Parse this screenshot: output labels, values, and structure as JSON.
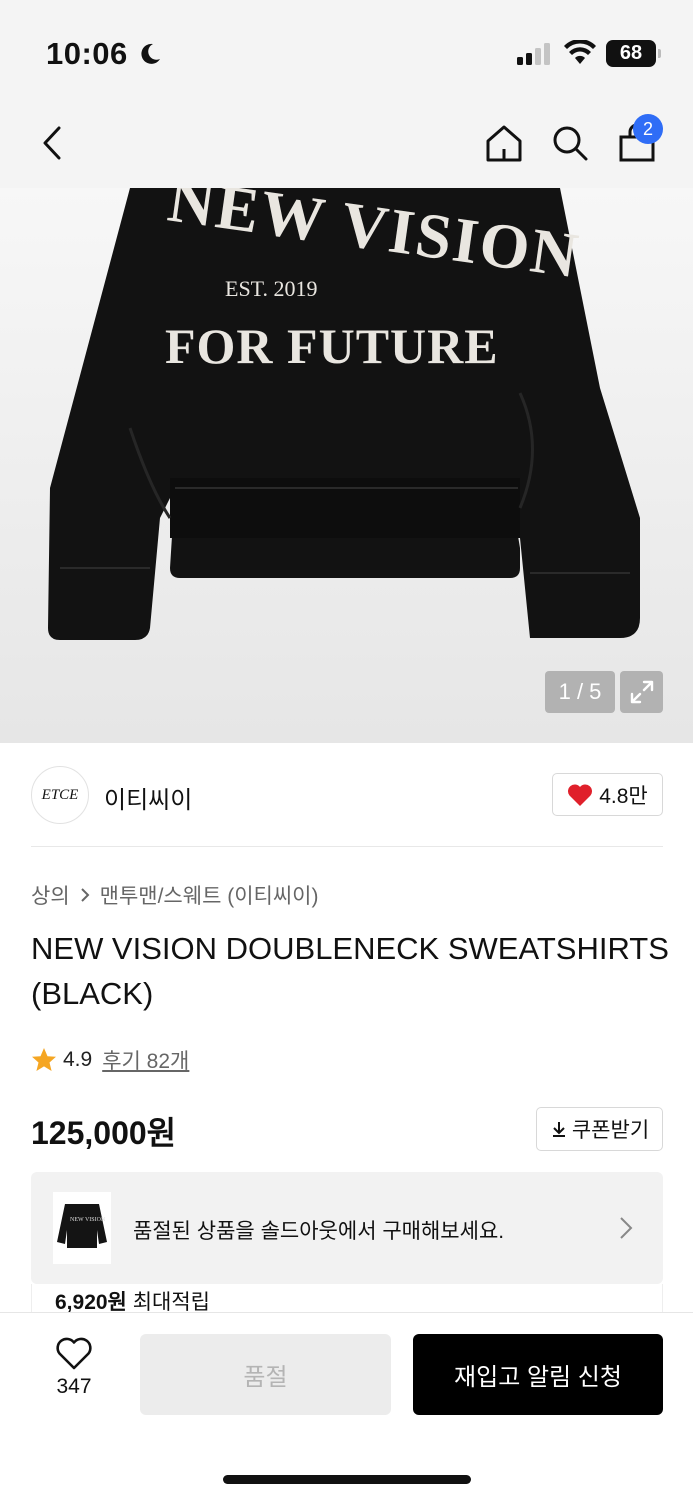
{
  "status_bar": {
    "time": "10:06",
    "battery": "68"
  },
  "nav": {
    "cart_count": "2",
    "icons": [
      "back-arrow-icon",
      "home-icon",
      "search-icon",
      "shopping-bag-icon"
    ]
  },
  "gallery": {
    "image_print_lines": [
      "NEW VISION",
      "EST. 2019",
      "FOR FUTURE"
    ],
    "counter": "1 / 5"
  },
  "brand": {
    "logo_text": "ETCE",
    "name": "이티씨이",
    "likes": "4.8만"
  },
  "product": {
    "breadcrumb": [
      "상의",
      "맨투맨/스웨트 (이티씨이)"
    ],
    "title": "NEW VISION DOUBLENECK SWEATSHIRTS (BLACK)",
    "rating": "4.9",
    "reviews": "후기 82개",
    "price": "125,000원",
    "coupon_label": "쿠폰받기"
  },
  "soldout_banner": {
    "thumb_print": "NEW VISION",
    "text": "품절된 상품을 솔드아웃에서 구매해보세요."
  },
  "points": {
    "amount": "6,920원",
    "label": "최대적립"
  },
  "bottom_bar": {
    "wish_count": "347",
    "soldout_label": "품절",
    "restock_label": "재입고 알림 신청"
  },
  "colors": {
    "accent_blue": "#2f6df6",
    "heart_red": "#e0202b",
    "star_orange": "#f5a623"
  }
}
